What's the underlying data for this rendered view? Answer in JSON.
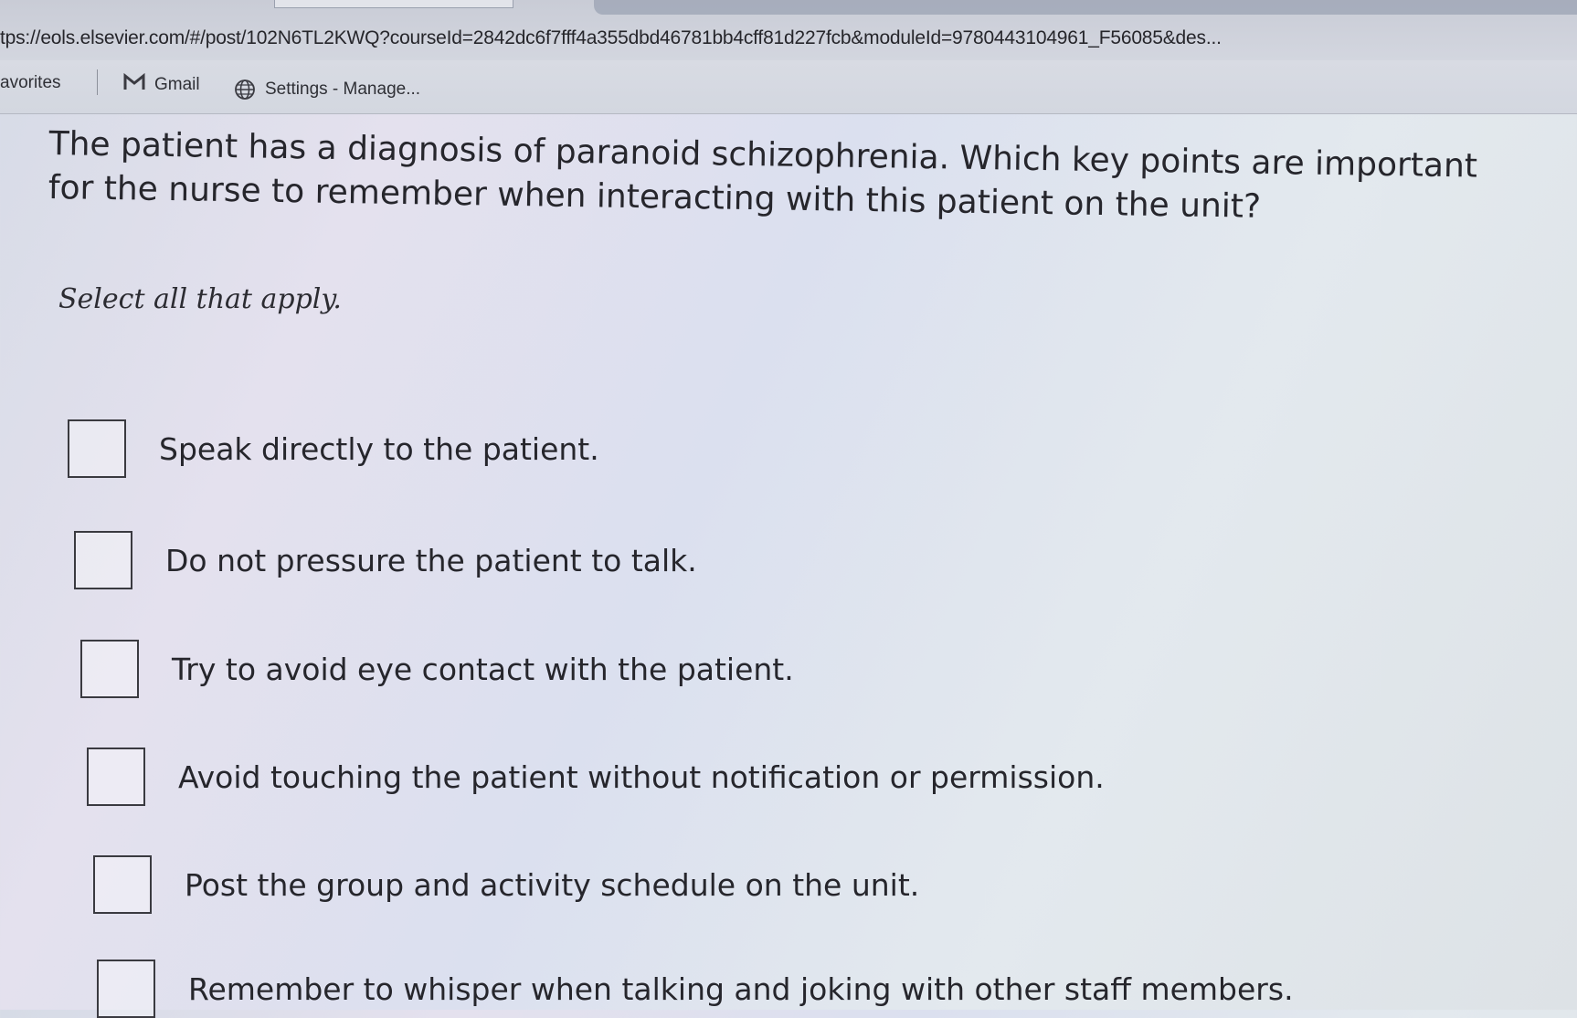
{
  "browser": {
    "url": "tps://eols.elsevier.com/#/post/102N6TL2KWQ?courseId=2842dc6f7fff4a355dbd46781bb4cff81d227fcb&moduleId=9780443104961_F56085&des...",
    "bookmarks": [
      {
        "label": "avorites",
        "icon": "star-icon"
      },
      {
        "label": "Gmail",
        "icon": "gmail-icon"
      },
      {
        "label": "Settings - Manage...",
        "icon": "globe-icon"
      }
    ],
    "icons": [
      "zoom-icon",
      "reader-icon",
      "star-icon",
      "refresh-icon",
      "favorites-icon",
      "profile-avatar"
    ]
  },
  "question": {
    "text": "The patient has a diagnosis of paranoid schizophrenia. Which key points are important for the nurse to remember when interacting with this patient on the unit?",
    "instruction": "Select all that apply."
  },
  "options": [
    {
      "label": "Speak directly to the patient.",
      "checked": false
    },
    {
      "label": "Do not pressure the patient to talk.",
      "checked": false
    },
    {
      "label": "Try to avoid eye contact with the patient.",
      "checked": false
    },
    {
      "label": "Avoid touching the patient without notification or permission.",
      "checked": false
    },
    {
      "label": "Post the group and activity schedule on the unit.",
      "checked": false
    },
    {
      "label": "Remember to whisper when talking and joking with other staff members.",
      "checked": false
    }
  ]
}
